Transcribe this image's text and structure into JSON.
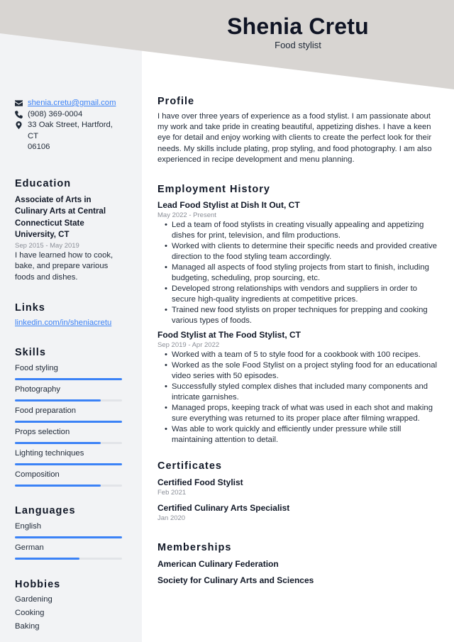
{
  "header": {
    "name": "Shenia Cretu",
    "role": "Food stylist",
    "bg_color": "#d8d5d2"
  },
  "contact": {
    "email": "shenia.cretu@gmail.com",
    "phone": "(908) 369-0004",
    "address_line1": "33 Oak Street, Hartford, CT",
    "address_line2": "06106"
  },
  "education": {
    "title": "Education",
    "degree": "Associate of Arts in Culinary Arts at Central Connecticut State University, CT",
    "dates": "Sep 2015 - May 2019",
    "description": "I have learned how to cook, bake, and prepare various foods and dishes."
  },
  "links": {
    "title": "Links",
    "items": [
      {
        "label": "linkedin.com/in/sheniacretu"
      }
    ]
  },
  "skills": {
    "title": "Skills",
    "items": [
      {
        "name": "Food styling",
        "level": 1.0
      },
      {
        "name": "Photography",
        "level": 0.8
      },
      {
        "name": "Food preparation",
        "level": 1.0
      },
      {
        "name": "Props selection",
        "level": 0.8
      },
      {
        "name": "Lighting techniques",
        "level": 1.0
      },
      {
        "name": "Composition",
        "level": 0.8
      }
    ]
  },
  "languages": {
    "title": "Languages",
    "items": [
      {
        "name": "English",
        "level": 1.0
      },
      {
        "name": "German",
        "level": 0.6
      }
    ]
  },
  "hobbies": {
    "title": "Hobbies",
    "items": [
      "Gardening",
      "Cooking",
      "Baking"
    ]
  },
  "profile": {
    "title": "Profile",
    "text": "I have over three years of experience as a food stylist. I am passionate about my work and take pride in creating beautiful, appetizing dishes. I have a keen eye for detail and enjoy working with clients to create the perfect look for their needs. My skills include plating, prop styling, and food photography. I am also experienced in recipe development and menu planning."
  },
  "employment": {
    "title": "Employment History",
    "jobs": [
      {
        "title": "Lead Food Stylist at Dish It Out, CT",
        "dates": "May 2022 - Present",
        "bullets": [
          "Led a team of food stylists in creating visually appealing and appetizing dishes for print, television, and film productions.",
          "Worked with clients to determine their specific needs and provided creative direction to the food styling team accordingly.",
          "Managed all aspects of food styling projects from start to finish, including budgeting, scheduling, prop sourcing, etc.",
          "Developed strong relationships with vendors and suppliers in order to secure high-quality ingredients at competitive prices.",
          "Trained new food stylists on proper techniques for prepping and cooking various types of foods."
        ]
      },
      {
        "title": "Food Stylist at The Food Stylist, CT",
        "dates": "Sep 2019 - Apr 2022",
        "bullets": [
          "Worked with a team of 5 to style food for a cookbook with 100 recipes.",
          "Worked as the sole Food Stylist on a project styling food for an educational video series with 50 episodes.",
          "Successfully styled complex dishes that included many components and intricate garnishes.",
          "Managed props, keeping track of what was used in each shot and making sure everything was returned to its proper place after filming wrapped.",
          "Was able to work quickly and efficiently under pressure while still maintaining attention to detail."
        ]
      }
    ]
  },
  "certificates": {
    "title": "Certificates",
    "items": [
      {
        "name": "Certified Food Stylist",
        "date": "Feb 2021"
      },
      {
        "name": "Certified Culinary Arts Specialist",
        "date": "Jan 2020"
      }
    ]
  },
  "memberships": {
    "title": "Memberships",
    "items": [
      "American Culinary Federation",
      "Society for Culinary Arts and Sciences"
    ]
  },
  "colors": {
    "accent": "#3b82f6",
    "sidebar_bg": "#f2f3f5"
  }
}
